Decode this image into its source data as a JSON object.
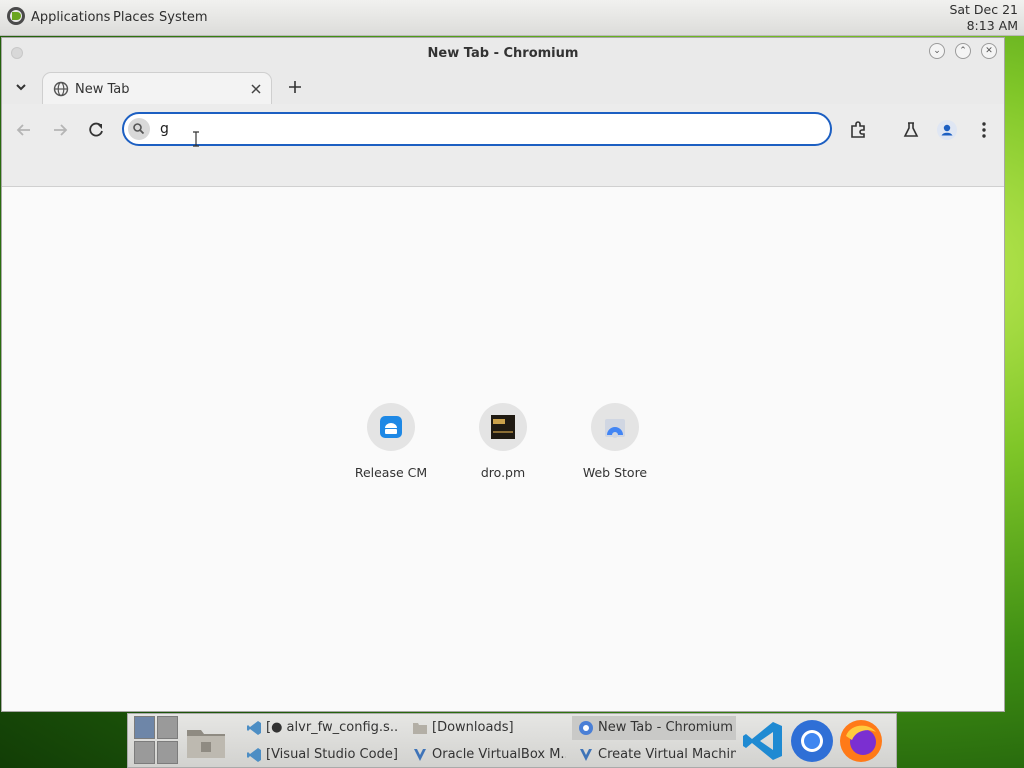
{
  "top_panel": {
    "menu": [
      "Applications",
      "Places",
      "System"
    ],
    "clock_date": "Sat Dec 21",
    "clock_time": "8:13 AM"
  },
  "window": {
    "title": "New Tab - Chromium",
    "controls": {
      "minimize": "⌄",
      "maximize": "⌃",
      "close": "✕"
    }
  },
  "tabs": [
    {
      "title": "New Tab",
      "icon": "globe-icon",
      "active": true
    }
  ],
  "omnibox": {
    "value": "g"
  },
  "shortcuts": [
    {
      "label": "Release CM",
      "icon": "android-icon",
      "color": "#1e88e5"
    },
    {
      "label": "dro.pm",
      "icon": "dro-pm-thumbnail-icon",
      "color": "#1f1a12"
    },
    {
      "label": "Web Store",
      "icon": "web-store-icon",
      "color": "#4285f4"
    }
  ],
  "taskbar": {
    "tasks": [
      {
        "label": "[● alvr_fw_config.s...",
        "icon": "vscode-icon",
        "active": false
      },
      {
        "label": "[Downloads]",
        "icon": "folder-icon",
        "active": false
      },
      {
        "label": "New Tab - Chromium",
        "icon": "chromium-icon",
        "active": true
      },
      {
        "label": "[Visual Studio Code]",
        "icon": "vscode-icon",
        "active": false
      },
      {
        "label": "Oracle VirtualBox M...",
        "icon": "virtualbox-icon",
        "active": false
      },
      {
        "label": "Create Virtual Machine",
        "icon": "virtualbox-icon",
        "active": false
      }
    ],
    "launchers": [
      "vscode-icon",
      "chromium-icon",
      "firefox-icon"
    ]
  },
  "colors": {
    "accent": "#1c5fc2",
    "vscode_blue": "#1f8ad2",
    "firefox_orange": "#ff7a18"
  }
}
